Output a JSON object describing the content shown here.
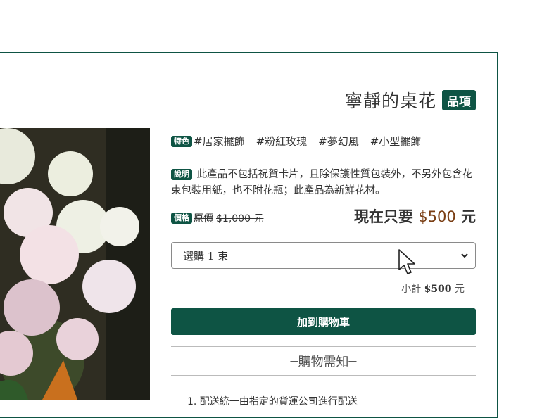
{
  "product": {
    "title": "寧靜的桌花",
    "title_badge": "品項",
    "tags_badge": "特色",
    "tags": [
      "#居家擺飾",
      "#粉紅玫瑰",
      "#夢幻風",
      "#小型擺飾"
    ],
    "desc_badge": "說明",
    "description": "此產品不包括祝賀卡片，且除保護性質包裝外，不另外包含花束包裝用紙，也不附花瓶；此產品為新鮮花材。",
    "price_badge": "價格",
    "original_label": "原價",
    "original_price": "$1,000 元",
    "now_label": "現在只要",
    "now_amount": "$500",
    "now_unit": "元"
  },
  "purchase": {
    "select_value": "選購 1 束",
    "subtotal_label": "小計",
    "subtotal_amount": "$500",
    "subtotal_unit": "元",
    "add_to_cart": "加到購物車"
  },
  "notice": {
    "heading": "─購物需知─",
    "items": [
      "1. 配送統一由指定的貨運公司進行配送"
    ]
  },
  "colors": {
    "brand_green": "#0e5444",
    "price_brown": "#7a3e14"
  },
  "icons": {
    "select": "chevron-down-icon",
    "cursor": "mouse-pointer-icon"
  }
}
